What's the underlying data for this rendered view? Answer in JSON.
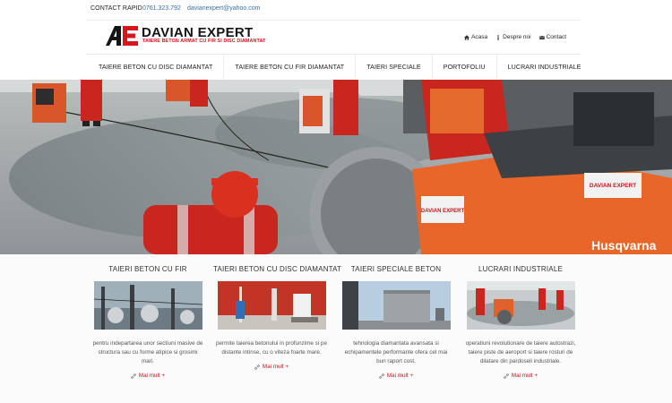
{
  "topbar": {
    "contact_label": "CONTACT RAPID",
    "phone": "0761.323.792",
    "email": "davianexpert@yahoo.com"
  },
  "logo": {
    "name": "DAVIAN EXPERT",
    "tagline": "TAIERE BETON ARMAT CU FIR SI DISC DIAMANTAT"
  },
  "header_menu": [
    {
      "label": "Acasa",
      "icon": "home-icon"
    },
    {
      "label": "Despre noi",
      "icon": "info-icon"
    },
    {
      "label": "Contact",
      "icon": "envelope-icon"
    }
  ],
  "main_nav": [
    "TAIERE BETON CU DISC DIAMANTAT",
    "TAIERE BETON CU FIR DIAMANTAT",
    "TAIERI SPECIALE",
    "PORTOFOLIU",
    "LUCRARI INDUSTRIALE"
  ],
  "hero": {
    "machine_brand": "Husqvarna",
    "sticker_text": "DAVIAN EXPERT"
  },
  "features": [
    {
      "title": "TAIERI BETON CU FIR",
      "description": "pentru indepartarea unor sectiuni masive de structura sau cu forme atipice si grosimi mari.",
      "more": "Mai mult +"
    },
    {
      "title": "TAIERI BETON CU DISC DIAMANTAT",
      "description": "permite taierea betonului in profunzime si pe distante intinse, cu o viteza foarte mare.",
      "more": "Mai mult +"
    },
    {
      "title": "TAIERI SPECIALE BETON",
      "description": "tehnologia diamantata avansata si echipamentele performante ofera cel mai bun raport cost.",
      "more": "Mai mult +"
    },
    {
      "title": "LUCRARI INDUSTRIALE",
      "description": "operatiuni revolutionare de taiere autostrazi, taiere piste de aeroport si taiere rosturi de dilatare din pardoseli industriale.",
      "more": "Mai mult +"
    }
  ],
  "colors": {
    "accent_red": "#c8151c",
    "link_blue": "#3a6fa8",
    "machine_orange": "#e8662a"
  }
}
